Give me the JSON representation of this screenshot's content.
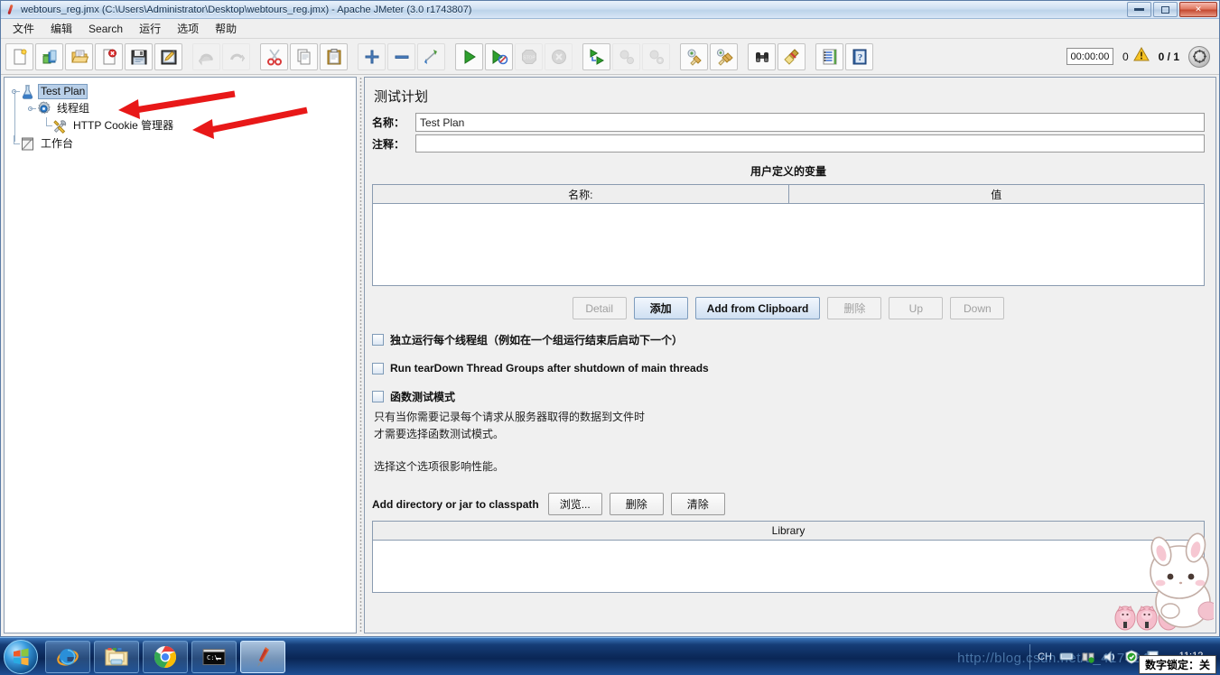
{
  "window": {
    "title": "webtours_reg.jmx (C:\\Users\\Administrator\\Desktop\\webtours_reg.jmx) - Apache JMeter (3.0 r1743807)",
    "app_icon": "jmeter-feather-icon",
    "controls": {
      "minimize": "minimize-button",
      "restore": "restore-button",
      "close": "close-button"
    }
  },
  "menubar": {
    "items": [
      {
        "label": "文件",
        "name": "menu-file"
      },
      {
        "label": "编辑",
        "name": "menu-edit"
      },
      {
        "label": "Search",
        "name": "menu-search"
      },
      {
        "label": "运行",
        "name": "menu-run"
      },
      {
        "label": "选项",
        "name": "menu-options"
      },
      {
        "label": "帮助",
        "name": "menu-help"
      }
    ]
  },
  "toolbar": {
    "group1": [
      {
        "icon": "new-document-icon",
        "enabled": true
      },
      {
        "icon": "templates-icon",
        "enabled": true
      },
      {
        "icon": "open-folder-icon",
        "enabled": true
      },
      {
        "icon": "close-document-icon",
        "enabled": true
      },
      {
        "icon": "save-icon",
        "enabled": true
      },
      {
        "icon": "save-as-icon",
        "enabled": true
      }
    ],
    "group2": [
      {
        "icon": "undo-icon",
        "enabled": false
      },
      {
        "icon": "redo-icon",
        "enabled": false
      }
    ],
    "group3": [
      {
        "icon": "cut-scissors-icon",
        "enabled": true
      },
      {
        "icon": "copy-icon",
        "enabled": true
      },
      {
        "icon": "paste-clipboard-icon",
        "enabled": true
      }
    ],
    "group4": [
      {
        "icon": "expand-all-plus-icon",
        "enabled": true
      },
      {
        "icon": "collapse-all-minus-icon",
        "enabled": true
      },
      {
        "icon": "toggle-node-icon",
        "enabled": true
      }
    ],
    "group5": [
      {
        "icon": "start-play-icon",
        "enabled": true
      },
      {
        "icon": "start-no-pauses-icon",
        "enabled": true
      },
      {
        "icon": "stop-icon",
        "enabled": false
      },
      {
        "icon": "shutdown-icon",
        "enabled": false
      }
    ],
    "group6": [
      {
        "icon": "start-remote-all-icon",
        "enabled": true
      },
      {
        "icon": "stop-remote-all-icon",
        "enabled": false
      },
      {
        "icon": "shutdown-remote-all-icon",
        "enabled": false
      }
    ],
    "group7": [
      {
        "icon": "clear-icon",
        "enabled": true
      },
      {
        "icon": "clear-all-icon",
        "enabled": true
      }
    ],
    "group8": [
      {
        "icon": "search-binoculars-icon",
        "enabled": true
      },
      {
        "icon": "search-reset-broom-icon",
        "enabled": true
      }
    ],
    "group9": [
      {
        "icon": "function-helper-icon",
        "enabled": true
      },
      {
        "icon": "help-book-icon",
        "enabled": true
      }
    ],
    "status": {
      "timer": "00:00:00",
      "warning_count": "0",
      "warning_icon": "warning-triangle-icon",
      "thread_counter": "0 / 1",
      "remote_icon": "thread-status-icon"
    }
  },
  "tree": {
    "nodes": [
      {
        "label": "Test Plan",
        "icon": "test-plan-beaker-icon",
        "selected": true,
        "depth": 0
      },
      {
        "label": "线程组",
        "icon": "thread-group-gear-icon",
        "selected": false,
        "depth": 1
      },
      {
        "label": "HTTP Cookie 管理器",
        "icon": "cookie-manager-tools-icon",
        "selected": false,
        "depth": 2
      },
      {
        "label": "工作台",
        "icon": "workbench-clipboard-icon",
        "selected": false,
        "depth": 0
      }
    ],
    "annotations": [
      {
        "name": "red-arrow-to-thread-group",
        "color": "#e81818"
      },
      {
        "name": "red-arrow-to-cookie-manager",
        "color": "#e81818"
      }
    ]
  },
  "main": {
    "panel_title": "测试计划",
    "fields": {
      "name_label": "名称：",
      "name_value": "Test Plan",
      "comment_label": "注释：",
      "comment_value": ""
    },
    "variables": {
      "section_title": "用户定义的变量",
      "columns": [
        "名称:",
        "值"
      ],
      "rows": []
    },
    "variable_buttons": [
      {
        "label": "Detail",
        "enabled": false,
        "name": "detail-button"
      },
      {
        "label": "添加",
        "enabled": true,
        "primary": true,
        "name": "add-button"
      },
      {
        "label": "Add from Clipboard",
        "enabled": true,
        "primary": true,
        "name": "add-from-clipboard-button"
      },
      {
        "label": "删除",
        "enabled": false,
        "name": "delete-button"
      },
      {
        "label": "Up",
        "enabled": false,
        "name": "up-button"
      },
      {
        "label": "Down",
        "enabled": false,
        "name": "down-button"
      }
    ],
    "checkboxes": [
      {
        "label": "独立运行每个线程组（例如在一个组运行结束后启动下一个）",
        "checked": false,
        "name": "serialize-thread-groups-checkbox"
      },
      {
        "label": "Run tearDown Thread Groups after shutdown of main threads",
        "checked": false,
        "name": "run-teardown-checkbox"
      },
      {
        "label": "函数测试模式",
        "checked": false,
        "name": "functional-test-mode-checkbox"
      }
    ],
    "help_text": [
      "只有当你需要记录每个请求从服务器取得的数据到文件时",
      "才需要选择函数测试模式。",
      "",
      "选择这个选项很影响性能。"
    ],
    "classpath": {
      "label": "Add directory or jar to classpath",
      "buttons": [
        {
          "label": "浏览...",
          "name": "browse-button"
        },
        {
          "label": "删除",
          "name": "classpath-delete-button"
        },
        {
          "label": "清除",
          "name": "classpath-clear-button"
        }
      ],
      "table_header": "Library",
      "rows": []
    }
  },
  "desktop_pet": {
    "name": "desktop-pet-bunny-with-pigs",
    "colors": {
      "body": "#ffffff",
      "outline": "#bda89f",
      "pig": "#f4bccb",
      "blush": "#f6c3cf"
    }
  },
  "taskbar": {
    "start_button": "start-orb-button",
    "apps": [
      {
        "name": "taskbar-internet-explorer",
        "icon": "internet-explorer-icon",
        "active": false
      },
      {
        "name": "taskbar-file-explorer",
        "icon": "folder-explorer-icon",
        "active": false
      },
      {
        "name": "taskbar-chrome",
        "icon": "chrome-icon",
        "active": false
      },
      {
        "name": "taskbar-command-prompt",
        "icon": "command-prompt-icon",
        "active": false
      },
      {
        "name": "taskbar-jmeter",
        "icon": "jmeter-feather-icon",
        "active": true
      }
    ],
    "tray": {
      "ime_label": "CH",
      "icons": [
        "ime-keyboard-icon",
        "network-icon",
        "volume-icon",
        "security-shield-icon",
        "flag-icon"
      ],
      "clock_time": "11:12",
      "numlock_tooltip": "数字锁定：关",
      "watermark": "http://blog.csdn.net/u_417424..."
    }
  },
  "colors": {
    "accent_selection": "#b8cfe8",
    "arrow_red": "#e81818",
    "panel_bg": "#f0f0f0",
    "border": "#8a9bb0"
  }
}
